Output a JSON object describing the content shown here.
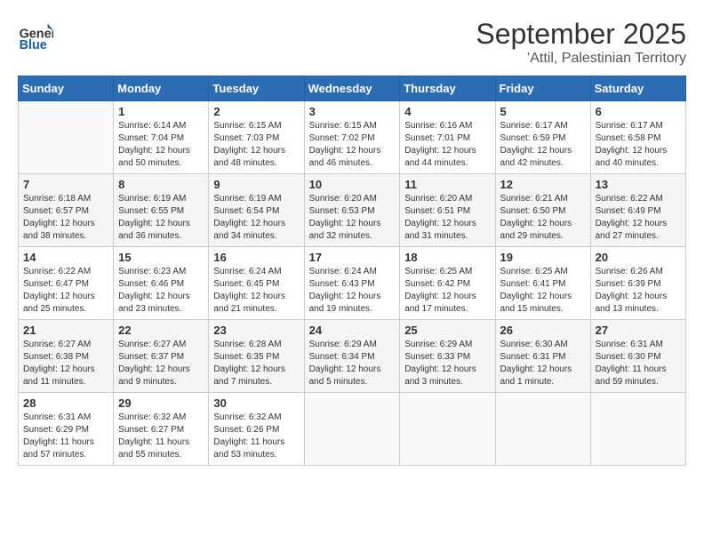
{
  "logo": {
    "general": "General",
    "blue": "Blue"
  },
  "title": "September 2025",
  "location": "'Attil, Palestinian Territory",
  "days_of_week": [
    "Sunday",
    "Monday",
    "Tuesday",
    "Wednesday",
    "Thursday",
    "Friday",
    "Saturday"
  ],
  "weeks": [
    [
      {
        "num": "",
        "sunrise": "",
        "sunset": "",
        "daylight": "",
        "empty": true
      },
      {
        "num": "1",
        "sunrise": "Sunrise: 6:14 AM",
        "sunset": "Sunset: 7:04 PM",
        "daylight": "Daylight: 12 hours and 50 minutes."
      },
      {
        "num": "2",
        "sunrise": "Sunrise: 6:15 AM",
        "sunset": "Sunset: 7:03 PM",
        "daylight": "Daylight: 12 hours and 48 minutes."
      },
      {
        "num": "3",
        "sunrise": "Sunrise: 6:15 AM",
        "sunset": "Sunset: 7:02 PM",
        "daylight": "Daylight: 12 hours and 46 minutes."
      },
      {
        "num": "4",
        "sunrise": "Sunrise: 6:16 AM",
        "sunset": "Sunset: 7:01 PM",
        "daylight": "Daylight: 12 hours and 44 minutes."
      },
      {
        "num": "5",
        "sunrise": "Sunrise: 6:17 AM",
        "sunset": "Sunset: 6:59 PM",
        "daylight": "Daylight: 12 hours and 42 minutes."
      },
      {
        "num": "6",
        "sunrise": "Sunrise: 6:17 AM",
        "sunset": "Sunset: 6:58 PM",
        "daylight": "Daylight: 12 hours and 40 minutes."
      }
    ],
    [
      {
        "num": "7",
        "sunrise": "Sunrise: 6:18 AM",
        "sunset": "Sunset: 6:57 PM",
        "daylight": "Daylight: 12 hours and 38 minutes."
      },
      {
        "num": "8",
        "sunrise": "Sunrise: 6:19 AM",
        "sunset": "Sunset: 6:55 PM",
        "daylight": "Daylight: 12 hours and 36 minutes."
      },
      {
        "num": "9",
        "sunrise": "Sunrise: 6:19 AM",
        "sunset": "Sunset: 6:54 PM",
        "daylight": "Daylight: 12 hours and 34 minutes."
      },
      {
        "num": "10",
        "sunrise": "Sunrise: 6:20 AM",
        "sunset": "Sunset: 6:53 PM",
        "daylight": "Daylight: 12 hours and 32 minutes."
      },
      {
        "num": "11",
        "sunrise": "Sunrise: 6:20 AM",
        "sunset": "Sunset: 6:51 PM",
        "daylight": "Daylight: 12 hours and 31 minutes."
      },
      {
        "num": "12",
        "sunrise": "Sunrise: 6:21 AM",
        "sunset": "Sunset: 6:50 PM",
        "daylight": "Daylight: 12 hours and 29 minutes."
      },
      {
        "num": "13",
        "sunrise": "Sunrise: 6:22 AM",
        "sunset": "Sunset: 6:49 PM",
        "daylight": "Daylight: 12 hours and 27 minutes."
      }
    ],
    [
      {
        "num": "14",
        "sunrise": "Sunrise: 6:22 AM",
        "sunset": "Sunset: 6:47 PM",
        "daylight": "Daylight: 12 hours and 25 minutes."
      },
      {
        "num": "15",
        "sunrise": "Sunrise: 6:23 AM",
        "sunset": "Sunset: 6:46 PM",
        "daylight": "Daylight: 12 hours and 23 minutes."
      },
      {
        "num": "16",
        "sunrise": "Sunrise: 6:24 AM",
        "sunset": "Sunset: 6:45 PM",
        "daylight": "Daylight: 12 hours and 21 minutes."
      },
      {
        "num": "17",
        "sunrise": "Sunrise: 6:24 AM",
        "sunset": "Sunset: 6:43 PM",
        "daylight": "Daylight: 12 hours and 19 minutes."
      },
      {
        "num": "18",
        "sunrise": "Sunrise: 6:25 AM",
        "sunset": "Sunset: 6:42 PM",
        "daylight": "Daylight: 12 hours and 17 minutes."
      },
      {
        "num": "19",
        "sunrise": "Sunrise: 6:25 AM",
        "sunset": "Sunset: 6:41 PM",
        "daylight": "Daylight: 12 hours and 15 minutes."
      },
      {
        "num": "20",
        "sunrise": "Sunrise: 6:26 AM",
        "sunset": "Sunset: 6:39 PM",
        "daylight": "Daylight: 12 hours and 13 minutes."
      }
    ],
    [
      {
        "num": "21",
        "sunrise": "Sunrise: 6:27 AM",
        "sunset": "Sunset: 6:38 PM",
        "daylight": "Daylight: 12 hours and 11 minutes."
      },
      {
        "num": "22",
        "sunrise": "Sunrise: 6:27 AM",
        "sunset": "Sunset: 6:37 PM",
        "daylight": "Daylight: 12 hours and 9 minutes."
      },
      {
        "num": "23",
        "sunrise": "Sunrise: 6:28 AM",
        "sunset": "Sunset: 6:35 PM",
        "daylight": "Daylight: 12 hours and 7 minutes."
      },
      {
        "num": "24",
        "sunrise": "Sunrise: 6:29 AM",
        "sunset": "Sunset: 6:34 PM",
        "daylight": "Daylight: 12 hours and 5 minutes."
      },
      {
        "num": "25",
        "sunrise": "Sunrise: 6:29 AM",
        "sunset": "Sunset: 6:33 PM",
        "daylight": "Daylight: 12 hours and 3 minutes."
      },
      {
        "num": "26",
        "sunrise": "Sunrise: 6:30 AM",
        "sunset": "Sunset: 6:31 PM",
        "daylight": "Daylight: 12 hours and 1 minute."
      },
      {
        "num": "27",
        "sunrise": "Sunrise: 6:31 AM",
        "sunset": "Sunset: 6:30 PM",
        "daylight": "Daylight: 11 hours and 59 minutes."
      }
    ],
    [
      {
        "num": "28",
        "sunrise": "Sunrise: 6:31 AM",
        "sunset": "Sunset: 6:29 PM",
        "daylight": "Daylight: 11 hours and 57 minutes."
      },
      {
        "num": "29",
        "sunrise": "Sunrise: 6:32 AM",
        "sunset": "Sunset: 6:27 PM",
        "daylight": "Daylight: 11 hours and 55 minutes."
      },
      {
        "num": "30",
        "sunrise": "Sunrise: 6:32 AM",
        "sunset": "Sunset: 6:26 PM",
        "daylight": "Daylight: 11 hours and 53 minutes."
      },
      {
        "num": "",
        "sunrise": "",
        "sunset": "",
        "daylight": "",
        "empty": true
      },
      {
        "num": "",
        "sunrise": "",
        "sunset": "",
        "daylight": "",
        "empty": true
      },
      {
        "num": "",
        "sunrise": "",
        "sunset": "",
        "daylight": "",
        "empty": true
      },
      {
        "num": "",
        "sunrise": "",
        "sunset": "",
        "daylight": "",
        "empty": true
      }
    ]
  ]
}
